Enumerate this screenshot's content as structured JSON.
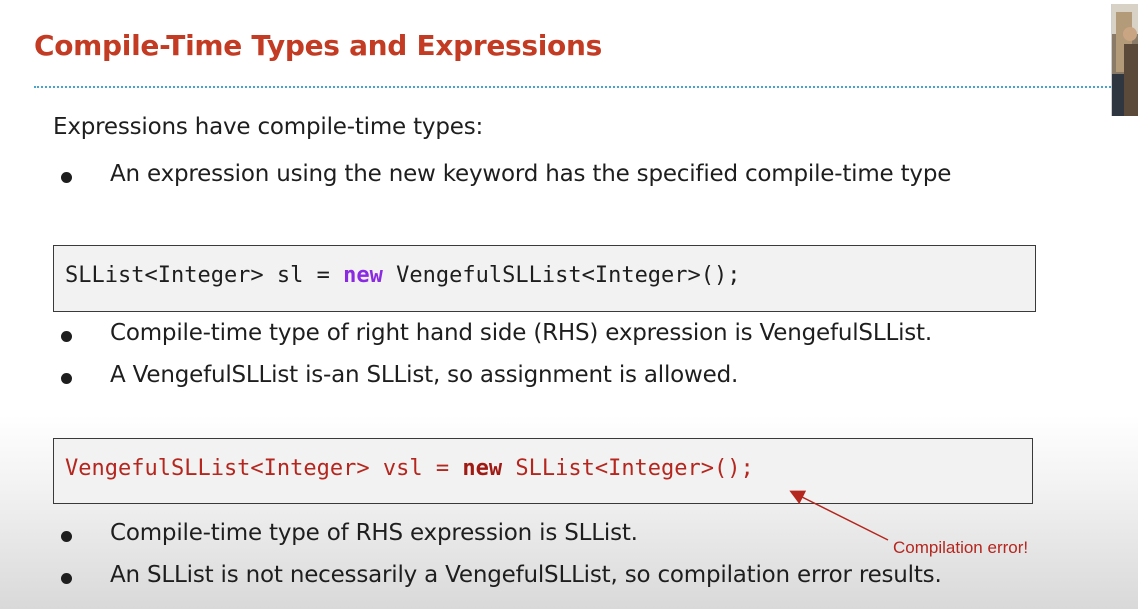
{
  "slide": {
    "title": "Compile-Time Types and Expressions",
    "intro": "Expressions have compile-time types:",
    "bullet_main": "An expression using the new keyword has the specified compile-time type",
    "example1": {
      "code_before": "SLList<Integer> sl = ",
      "keyword": "new",
      "code_after": " VengefulSLList<Integer>();",
      "bullets": [
        "Compile-time type of right hand side (RHS) expression is VengefulSLList.",
        "A VengefulSLList is-an SLList, so assignment is allowed."
      ]
    },
    "example2": {
      "code_before": "VengefulSLList<Integer> vsl = ",
      "keyword": "new",
      "code_after": " SLList<Integer>();",
      "annotation": "Compilation error!",
      "bullets": [
        "Compile-time type of RHS expression is SLList.",
        "An SLList is not necessarily a VengefulSLList, so compilation error results."
      ]
    }
  },
  "colors": {
    "title": "#c23b22",
    "rule": "#4aa3c8",
    "error_red": "#b5261e",
    "keyword_purple": "#8a2be2"
  },
  "icons": {
    "webcam": "presenter-webcam-thumbnail"
  }
}
